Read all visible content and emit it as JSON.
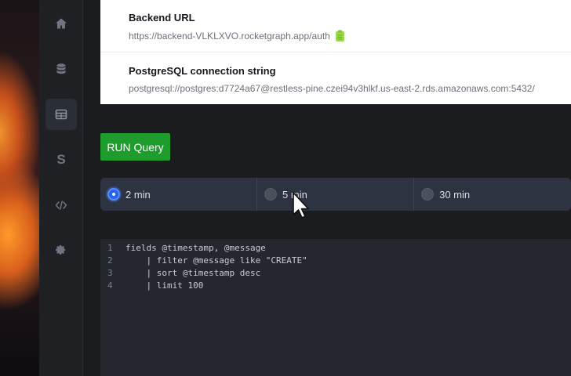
{
  "settings": {
    "backend_url_label": "Backend URL",
    "backend_url_value": "https://backend-VLKLXVO.rocketgraph.app/auth",
    "postgres_label": "PostgreSQL connection string",
    "postgres_value": "postgresql://postgres:d7724a67@restless-pine.czei94v3hlkf.us-east-2.rds.amazonaws.com:5432/"
  },
  "query": {
    "run_label": "RUN Query",
    "ranges": [
      {
        "label": "2 min",
        "selected": true
      },
      {
        "label": "5 min",
        "selected": false
      },
      {
        "label": "30 min",
        "selected": false
      }
    ]
  },
  "editor": {
    "lines": [
      {
        "num": "1",
        "code": "fields @timestamp, @message"
      },
      {
        "num": "2",
        "code": "    | filter @message like \"CREATE\""
      },
      {
        "num": "3",
        "code": "    | sort @timestamp desc"
      },
      {
        "num": "4",
        "code": "    | limit 100"
      }
    ]
  },
  "sidebar": {
    "items": [
      {
        "icon": "home-icon"
      },
      {
        "icon": "database-icon"
      },
      {
        "icon": "table-icon"
      },
      {
        "icon": "storage-icon",
        "text": "S"
      },
      {
        "icon": "code-icon"
      },
      {
        "icon": "gear-icon"
      }
    ]
  },
  "colors": {
    "run_button": "#1f9d2c",
    "radio_selected": "#2563eb",
    "copy_icon": "#9ad94a"
  }
}
